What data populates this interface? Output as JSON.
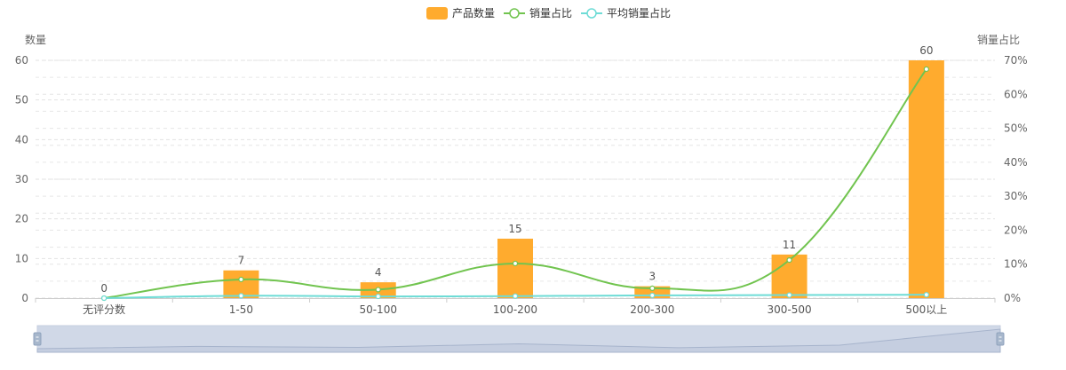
{
  "chart_data": {
    "type": "bar",
    "categories": [
      "无评分数",
      "1-50",
      "50-100",
      "100-200",
      "200-300",
      "300-500",
      "500以上"
    ],
    "series": [
      {
        "name": "产品数量",
        "kind": "bar",
        "axis": "left",
        "values": [
          0,
          7,
          4,
          15,
          3,
          11,
          60
        ],
        "color": "#FFAB2E"
      },
      {
        "name": "销量占比",
        "kind": "line",
        "axis": "right",
        "values": [
          0,
          5.5,
          2.5,
          10.2,
          2.9,
          11.2,
          67.4
        ],
        "color": "#71C44F"
      },
      {
        "name": "平均销量占比",
        "kind": "line",
        "axis": "right",
        "values": [
          0,
          0.7,
          0.5,
          0.6,
          0.8,
          0.9,
          1.0
        ],
        "color": "#6EDCD6"
      }
    ],
    "left_axis": {
      "label": "数量",
      "min": 0,
      "max": 60,
      "ticks": [
        "0",
        "10",
        "20",
        "30",
        "40",
        "50",
        "60"
      ]
    },
    "right_axis": {
      "label": "销量占比",
      "min": 0,
      "max": 70,
      "ticks": [
        "0%",
        "10%",
        "20%",
        "30%",
        "40%",
        "50%",
        "60%",
        "70%"
      ]
    },
    "bar_data_labels": [
      "0",
      "7",
      "4",
      "15",
      "3",
      "11",
      "60"
    ],
    "grid": true,
    "legend_position": "top-center",
    "data_zoom_slider": {
      "visible": true,
      "start_percent": 0,
      "end_percent": 100
    }
  }
}
